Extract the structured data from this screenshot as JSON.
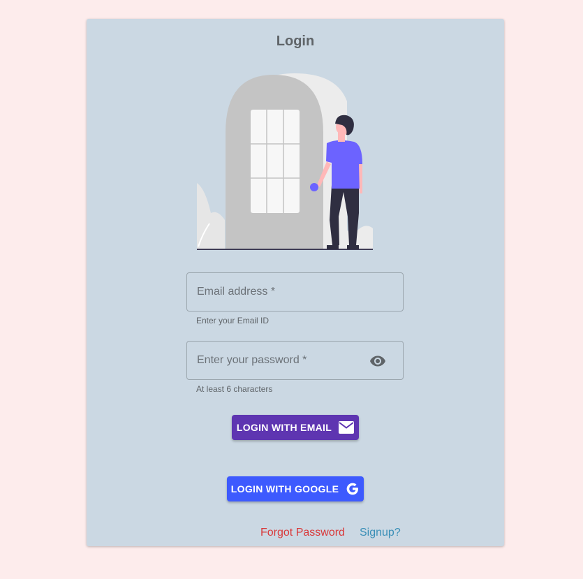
{
  "login": {
    "title": "Login",
    "email": {
      "label": "Email address *",
      "helper": "Enter your Email ID",
      "value": ""
    },
    "password": {
      "label": "Enter your password *",
      "helper": "At least 6 characters",
      "value": "",
      "toggle_icon": "eye-icon"
    },
    "buttons": {
      "email_label": "LOGIN WITH EMAIL",
      "email_icon": "mail-icon",
      "google_label": "LOGIN WITH GOOGLE",
      "google_icon": "google-icon"
    },
    "links": {
      "forgot": "Forgot Password",
      "signup": "Signup?"
    }
  },
  "colors": {
    "page_background": "#fdecec",
    "card_background": "#cbd8e3",
    "email_button": "#5e35b1",
    "google_button": "#3d5afe",
    "forgot_link": "#d9393a",
    "signup_link": "#3a8fb7",
    "illustration_accent": "#6c63ff"
  }
}
